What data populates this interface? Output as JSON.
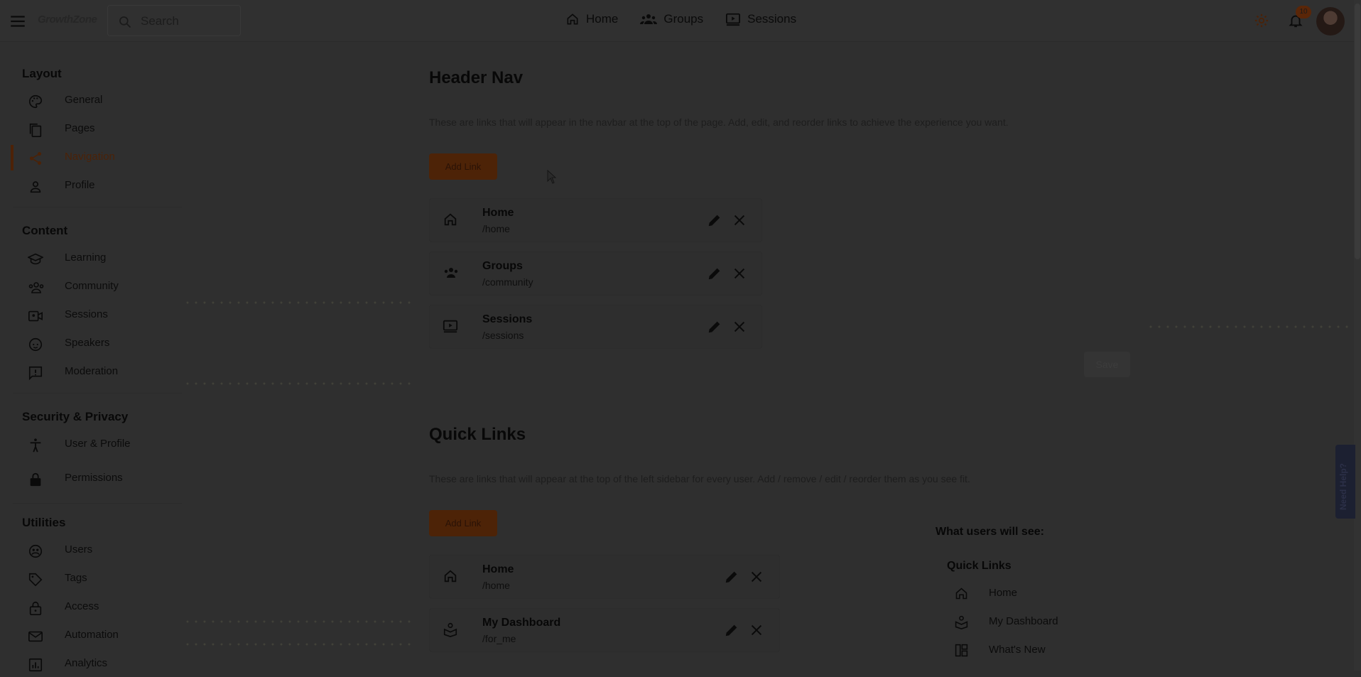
{
  "app": {
    "logo_text": "GrowthZone",
    "search_placeholder": "Search",
    "notification_count": "10"
  },
  "topnav": [
    {
      "label": "Home",
      "icon": "home-icon"
    },
    {
      "label": "Groups",
      "icon": "groups-icon"
    },
    {
      "label": "Sessions",
      "icon": "sessions-icon"
    }
  ],
  "sidebar": {
    "sections": [
      {
        "title": "Layout",
        "items": [
          {
            "label": "General",
            "icon": "palette-icon"
          },
          {
            "label": "Pages",
            "icon": "pages-icon"
          },
          {
            "label": "Navigation",
            "icon": "share-icon",
            "active": true
          },
          {
            "label": "Profile",
            "icon": "person-icon"
          }
        ]
      },
      {
        "title": "Content",
        "items": [
          {
            "label": "Learning",
            "icon": "school-icon"
          },
          {
            "label": "Community",
            "icon": "groups-icon"
          },
          {
            "label": "Sessions",
            "icon": "video-icon"
          },
          {
            "label": "Speakers",
            "icon": "face-icon"
          },
          {
            "label": "Moderation",
            "icon": "report-icon"
          }
        ]
      },
      {
        "title": "Security & Privacy",
        "items": [
          {
            "label": "User & Profile",
            "icon": "accessibility-icon"
          },
          {
            "label": "Permissions",
            "icon": "lock-icon"
          }
        ]
      },
      {
        "title": "Utilities",
        "items": [
          {
            "label": "Users",
            "icon": "users-icon"
          },
          {
            "label": "Tags",
            "icon": "tag-icon"
          },
          {
            "label": "Access",
            "icon": "lock-open-icon"
          },
          {
            "label": "Automation",
            "icon": "mail-icon"
          },
          {
            "label": "Analytics",
            "icon": "analytics-icon"
          }
        ]
      }
    ]
  },
  "header_nav": {
    "title": "Header Nav",
    "description": "These are links that will appear in the navbar at the top of the page. Add, edit, and reorder links to achieve the experience you want.",
    "add_label": "Add Link",
    "save_label": "Save",
    "links": [
      {
        "title": "Home",
        "path": "/home",
        "icon": "home-icon"
      },
      {
        "title": "Groups",
        "path": "/community",
        "icon": "groups-icon"
      },
      {
        "title": "Sessions",
        "path": "/sessions",
        "icon": "sessions-icon"
      }
    ]
  },
  "quick_links": {
    "title": "Quick Links",
    "description": "These are links that will appear at the top of the left sidebar for every user. Add / remove / edit / reorder them as you see fit.",
    "add_label": "Add Link",
    "links": [
      {
        "title": "Home",
        "path": "/home",
        "icon": "home-icon"
      },
      {
        "title": "My Dashboard",
        "path": "/for_me",
        "icon": "dashboard-person-icon"
      }
    ],
    "preview_title": "What users will see:",
    "preview_subtitle": "Quick Links",
    "preview_items": [
      {
        "label": "Home",
        "icon": "home-icon"
      },
      {
        "label": "My Dashboard",
        "icon": "dashboard-person-icon"
      },
      {
        "label": "What's New",
        "icon": "dashboard-icon"
      }
    ]
  },
  "help": {
    "label": "Need Help?"
  }
}
